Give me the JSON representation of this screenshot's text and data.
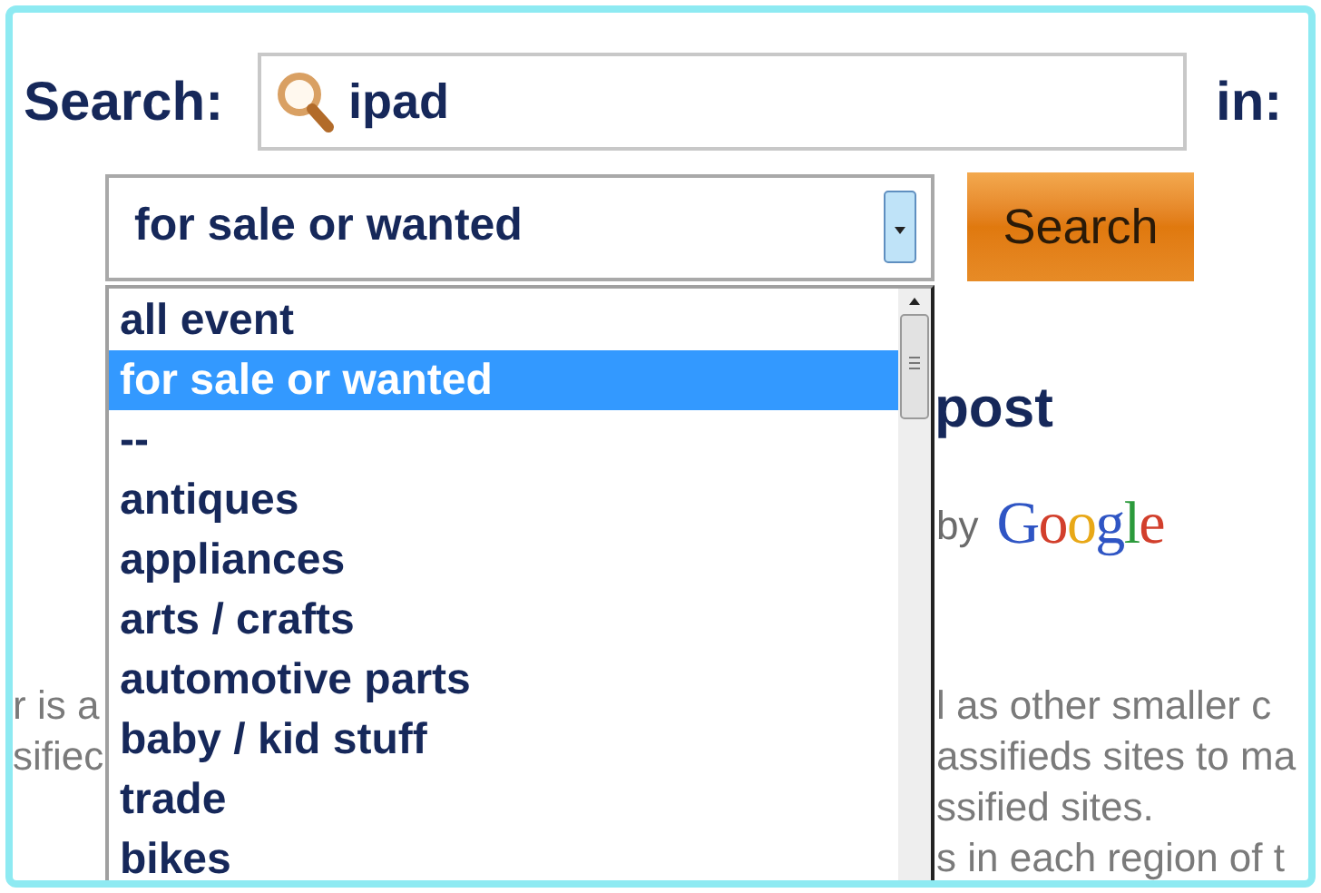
{
  "search": {
    "label": "Search:",
    "value": "ipad",
    "in_label": "in:"
  },
  "category_select": {
    "value": "for sale or wanted",
    "expanded": true
  },
  "search_button": "Search",
  "dropdown": {
    "items": [
      {
        "label": "all event",
        "selected": false
      },
      {
        "label": "for sale or wanted",
        "selected": true
      },
      {
        "label": "--",
        "selected": false
      },
      {
        "label": "antiques",
        "selected": false
      },
      {
        "label": "appliances",
        "selected": false
      },
      {
        "label": "arts / crafts",
        "selected": false
      },
      {
        "label": "automotive parts",
        "selected": false
      },
      {
        "label": "baby / kid stuff",
        "selected": false
      },
      {
        "label": "trade",
        "selected": false
      },
      {
        "label": "bikes",
        "selected": false
      }
    ]
  },
  "background": {
    "heading": "post",
    "powered_by": "by",
    "logo": "Google",
    "text_lines": [
      {
        "left": "r is a",
        "right": "l as other smaller c"
      },
      {
        "left": "sifiec",
        "right": "assifieds sites to ma"
      },
      {
        "right": "ssified sites."
      },
      {
        "right": "s in each region of t"
      }
    ]
  }
}
